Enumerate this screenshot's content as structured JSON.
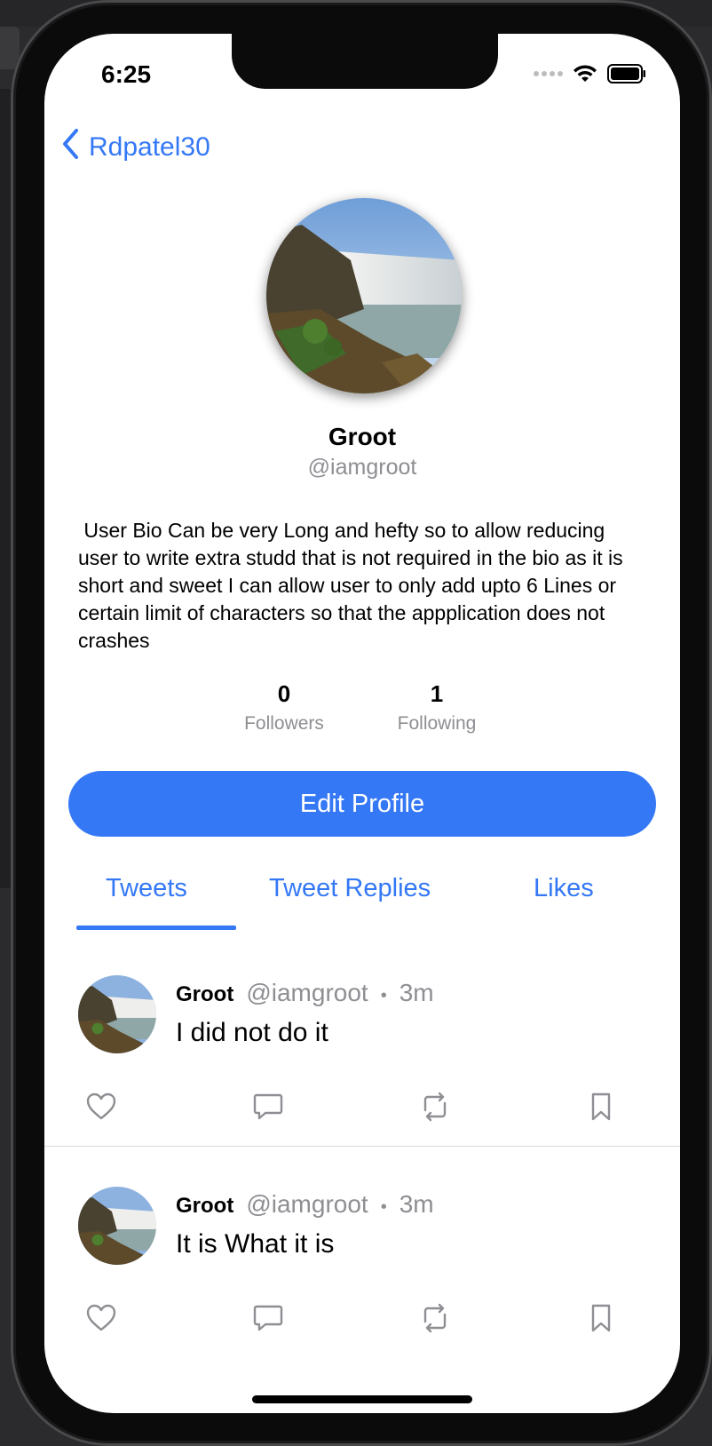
{
  "status_bar": {
    "time": "6:25"
  },
  "nav": {
    "back_label": "Rdpatel30"
  },
  "profile": {
    "name": "Groot",
    "handle": "@iamgroot",
    "bio": " User Bio Can be very Long and hefty so to allow reducing user to write extra studd that is not required in the bio as it is short and sweet I can allow user to only add upto 6 Lines or certain limit of characters so that the appplication does not crashes",
    "followers": {
      "count": "0",
      "label": "Followers"
    },
    "following": {
      "count": "1",
      "label": "Following"
    },
    "edit_button": "Edit Profile"
  },
  "tabs": [
    {
      "label": "Tweets",
      "selected": true
    },
    {
      "label": "Tweet Replies",
      "selected": false
    },
    {
      "label": "Likes",
      "selected": false
    }
  ],
  "tweets": [
    {
      "name": "Groot",
      "handle": "@iamgroot",
      "dot": "•",
      "time": "3m",
      "text": "I did not do it"
    },
    {
      "name": "Groot",
      "handle": "@iamgroot",
      "dot": "•",
      "time": "3m",
      "text": "It is What it is"
    }
  ],
  "colors": {
    "accent": "#3478f6",
    "secondary_text": "#8e8e93"
  },
  "icons": {
    "back": "chevron-left-icon",
    "actions": [
      "heart-icon",
      "comment-icon",
      "retweet-icon",
      "bookmark-icon"
    ]
  }
}
